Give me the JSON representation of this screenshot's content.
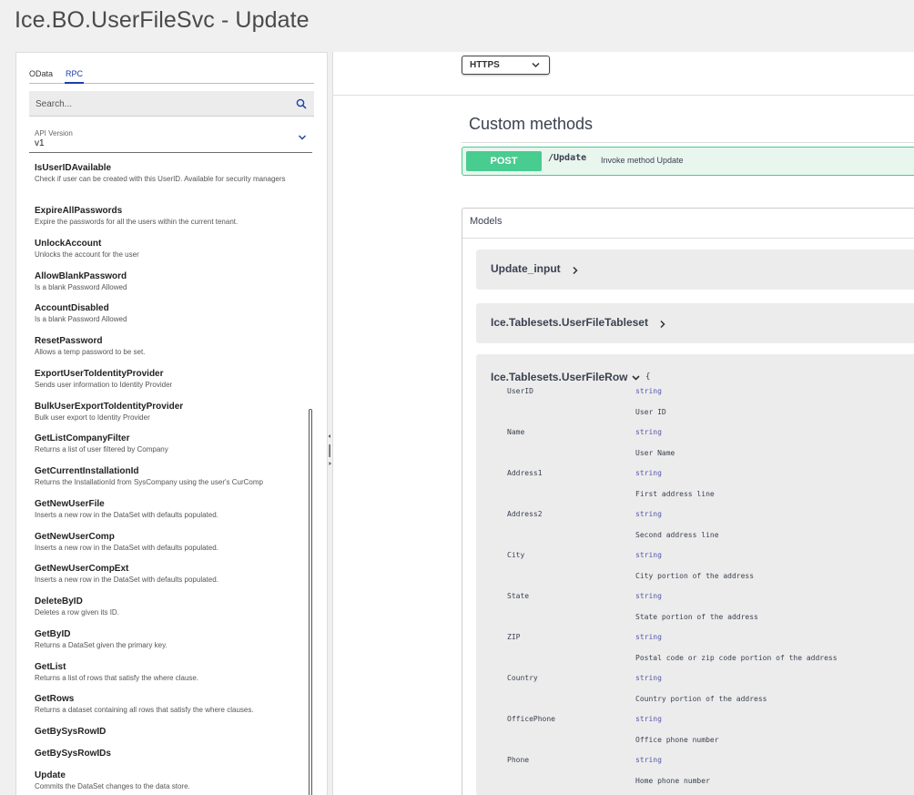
{
  "title": "Ice.BO.UserFileSvc - Update",
  "tabs": [
    {
      "label": "OData",
      "active": false
    },
    {
      "label": "RPC",
      "active": true
    }
  ],
  "search": {
    "placeholder": "Search...",
    "icon": "search-icon"
  },
  "api_version": {
    "label": "API Version",
    "value": "v1"
  },
  "methods": [
    {
      "name": "IsUserIDAvailable",
      "desc": "Check if user can be created with this UserID. Available for security managers"
    },
    {
      "name": "ExpireAllPasswords",
      "desc": "Expire the passwords for all the users within the current tenant."
    },
    {
      "name": "UnlockAccount",
      "desc": "Unlocks the account for the user"
    },
    {
      "name": "AllowBlankPassword",
      "desc": "Is a blank Password Allowed"
    },
    {
      "name": "AccountDisabled",
      "desc": "Is a blank Password Allowed"
    },
    {
      "name": "ResetPassword",
      "desc": "Allows a temp password to be set."
    },
    {
      "name": "ExportUserToIdentityProvider",
      "desc": "Sends user information to Identity Provider"
    },
    {
      "name": "BulkUserExportToIdentityProvider",
      "desc": "Bulk user export to Identity Provider"
    },
    {
      "name": "GetListCompanyFilter",
      "desc": "Returns a list of user filtered by Company"
    },
    {
      "name": "GetCurrentInstallationId",
      "desc": "Returns the InstallationId from SysCompany using the user's CurComp"
    },
    {
      "name": "GetNewUserFile",
      "desc": "Inserts a new row in the DataSet with defaults populated."
    },
    {
      "name": "GetNewUserComp",
      "desc": "Inserts a new row in the DataSet with defaults populated."
    },
    {
      "name": "GetNewUserCompExt",
      "desc": "Inserts a new row in the DataSet with defaults populated."
    },
    {
      "name": "DeleteByID",
      "desc": "Deletes a row given its ID."
    },
    {
      "name": "GetByID",
      "desc": "Returns a DataSet given the primary key."
    },
    {
      "name": "GetList",
      "desc": "Returns a list of rows that satisfy the where clause."
    },
    {
      "name": "GetRows",
      "desc": "Returns a dataset containing all rows that satisfy the where clauses."
    },
    {
      "name": "GetBySysRowID",
      "desc": ""
    },
    {
      "name": "GetBySysRowIDs",
      "desc": ""
    },
    {
      "name": "Update",
      "desc": "Commits the DataSet changes to the data store."
    }
  ],
  "scheme": {
    "value": "HTTPS"
  },
  "custom_methods": {
    "title": "Custom methods",
    "operation": {
      "method": "POST",
      "path": "/Update",
      "summary": "Invoke method Update",
      "color": "#49cc90"
    }
  },
  "models": {
    "header": "Models",
    "items": [
      {
        "name": "Update_input",
        "expanded": false
      },
      {
        "name": "Ice.Tablesets.UserFileTableset",
        "expanded": false
      },
      {
        "name": "Ice.Tablesets.UserFileRow",
        "expanded": true,
        "brace": "{"
      }
    ],
    "properties": [
      {
        "name": "UserID",
        "type": "string",
        "desc": "User ID"
      },
      {
        "name": "Name",
        "type": "string",
        "desc": "User Name"
      },
      {
        "name": "Address1",
        "type": "string",
        "desc": "First address line"
      },
      {
        "name": "Address2",
        "type": "string",
        "desc": "Second address line"
      },
      {
        "name": "City",
        "type": "string",
        "desc": "City portion of the address"
      },
      {
        "name": "State",
        "type": "string",
        "desc": "State portion of the address"
      },
      {
        "name": "ZIP",
        "type": "string",
        "desc": "Postal code or zip code portion of the address"
      },
      {
        "name": "Country",
        "type": "string",
        "desc": "Country portion of the address"
      },
      {
        "name": "OfficePhone",
        "type": "string",
        "desc": "Office phone number"
      },
      {
        "name": "Phone",
        "type": "string",
        "desc": "Home phone number"
      }
    ]
  }
}
